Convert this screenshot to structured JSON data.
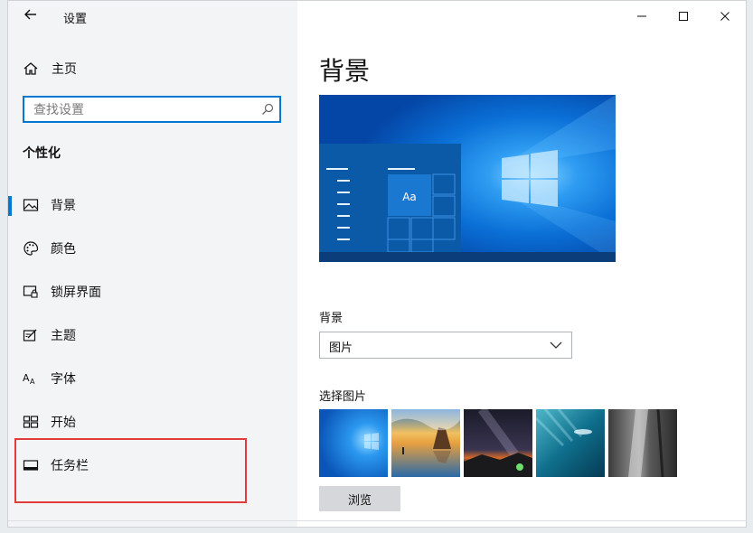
{
  "app": {
    "title": "设置",
    "back_symbol": "←"
  },
  "sidebar": {
    "home_label": "主页",
    "search_placeholder": "查找设置",
    "section_title": "个性化",
    "items": [
      {
        "label": "背景",
        "icon": "picture-icon",
        "active": true
      },
      {
        "label": "颜色",
        "icon": "palette-icon",
        "active": false
      },
      {
        "label": "锁屏界面",
        "icon": "lock-screen-icon",
        "active": false
      },
      {
        "label": "主题",
        "icon": "theme-icon",
        "active": false
      },
      {
        "label": "字体",
        "icon": "font-icon",
        "active": false
      },
      {
        "label": "开始",
        "icon": "start-icon",
        "active": false
      },
      {
        "label": "任务栏",
        "icon": "taskbar-icon",
        "active": false
      }
    ]
  },
  "main": {
    "title": "背景",
    "preview": {
      "tile_text": "Aa"
    },
    "background_label": "背景",
    "background_value": "图片",
    "choose_label": "选择图片",
    "browse_label": "浏览"
  },
  "colors": {
    "accent": "#0078d4",
    "highlight": "#e23b3b"
  }
}
